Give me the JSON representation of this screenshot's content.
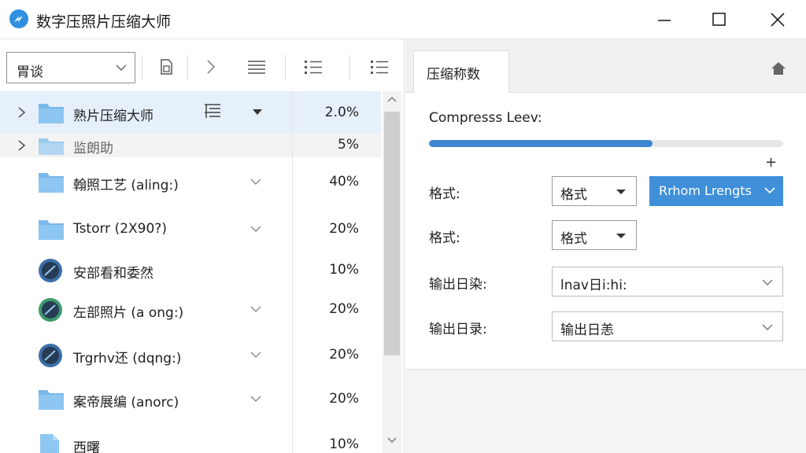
{
  "window": {
    "title": "数字压照片压缩大师",
    "controls": [
      "minimize",
      "maximize",
      "close"
    ]
  },
  "toolbar": {
    "view_select": "胃谈",
    "icons": [
      "copy-file-icon",
      "chevron-right-icon",
      "list-view-icon",
      "bullet-list-icon",
      "bullet-list-icon"
    ]
  },
  "file_list": {
    "rows": [
      {
        "name": "熟片压缩大师",
        "percent": "2.0%",
        "icon": "folder-icon",
        "expandable": true,
        "selected": true
      },
      {
        "name": "监朗助",
        "percent": "5%",
        "icon": "folder-icon",
        "expandable": true,
        "selected": false
      },
      {
        "name": "翰照工艺 (aling:)",
        "percent": "40%",
        "icon": "folder-icon",
        "expandable": false,
        "selected": false
      },
      {
        "name": "Tstorr (2X90?)",
        "percent": "20%",
        "icon": "folder-icon",
        "expandable": false,
        "selected": false
      },
      {
        "name": "安部看和委然",
        "percent": "10%",
        "icon": "disc-icon",
        "expandable": false,
        "selected": false
      },
      {
        "name": "左部照片 (a ong:)",
        "percent": "20%",
        "icon": "disc-icon",
        "expandable": false,
        "selected": false
      },
      {
        "name": "Trgrhv还 (dqng:)",
        "percent": "20%",
        "icon": "disc-icon",
        "expandable": false,
        "selected": false
      },
      {
        "name": "案帝展编 (anorc)",
        "percent": "20%",
        "icon": "folder-icon",
        "expandable": false,
        "selected": false
      },
      {
        "name": "西曙",
        "percent": "10%",
        "icon": "document-icon",
        "expandable": false,
        "selected": false
      }
    ]
  },
  "settings_panel": {
    "tab_label": "压缩称数",
    "compress_level_label": "Compresss Leev:",
    "compress_level_value": 0.63,
    "plus_label": "+",
    "format_label_1": "格式:",
    "format_select_1": "格式",
    "strength_button": "Rrhom Lrengts",
    "format_label_2": "格式:",
    "format_select_2": "格式",
    "output_dir_label_1": "输出日染:",
    "output_dir_value_1": "lnav日i:hi:",
    "output_dir_label_2": "输出日录:",
    "output_dir_value_2": "输出日恙"
  },
  "colors": {
    "accent": "#3f8fd9",
    "progress": "#3e86d0",
    "selected_row": "#e6f0fb",
    "folder": "#7ab8ea"
  }
}
